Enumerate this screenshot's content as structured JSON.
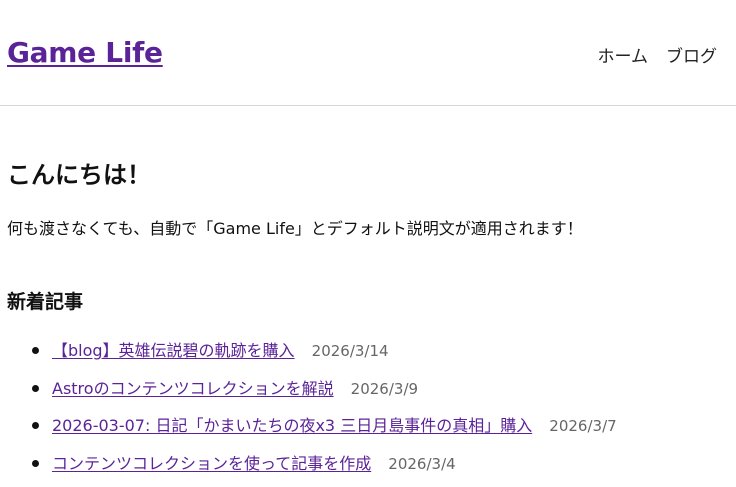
{
  "header": {
    "site_title": "Game Life",
    "nav": [
      {
        "label": "ホーム"
      },
      {
        "label": "ブログ"
      }
    ]
  },
  "main": {
    "greeting": "こんにちは！",
    "intro": "何も渡さなくても、自動で「Game Life」とデフォルト説明文が適用されます！",
    "recent_title": "新着記事",
    "posts": [
      {
        "title": "【blog】英雄伝説碧の軌跡を購入",
        "date": "2026/3/14"
      },
      {
        "title": "Astroのコンテンツコレクションを解説",
        "date": "2026/3/9"
      },
      {
        "title": "2026-03-07: 日記「かまいたちの夜x3 三日月島事件の真相」購入",
        "date": "2026/3/7"
      },
      {
        "title": "コンテンツコレクションを使って記事を作成",
        "date": "2026/3/4"
      }
    ]
  },
  "colors": {
    "link": "#5b2398",
    "date": "#666666",
    "divider": "#d6d6d6"
  }
}
